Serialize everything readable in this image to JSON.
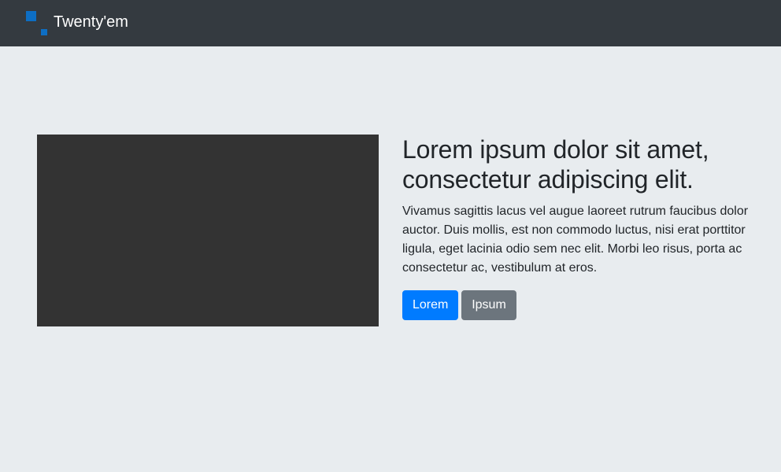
{
  "navbar": {
    "brand_name": "Twenty'em",
    "logo_icon": "logo-squares-icon",
    "logo_color": "#0d6ec4",
    "background": "#343a40"
  },
  "hero": {
    "media_color": "#333333",
    "heading": "Lorem ipsum dolor sit amet, consectetur adipiscing elit.",
    "description": "Vivamus sagittis lacus vel augue laoreet rutrum faucibus dolor auctor. Duis mollis, est non commodo luctus, nisi erat porttitor ligula, eget lacinia odio sem nec elit. Morbi leo risus, porta ac consectetur ac, vestibulum at eros.",
    "primary_button_label": "Lorem",
    "secondary_button_label": "Ipsum",
    "primary_color": "#007bff",
    "secondary_color": "#6c757d"
  }
}
